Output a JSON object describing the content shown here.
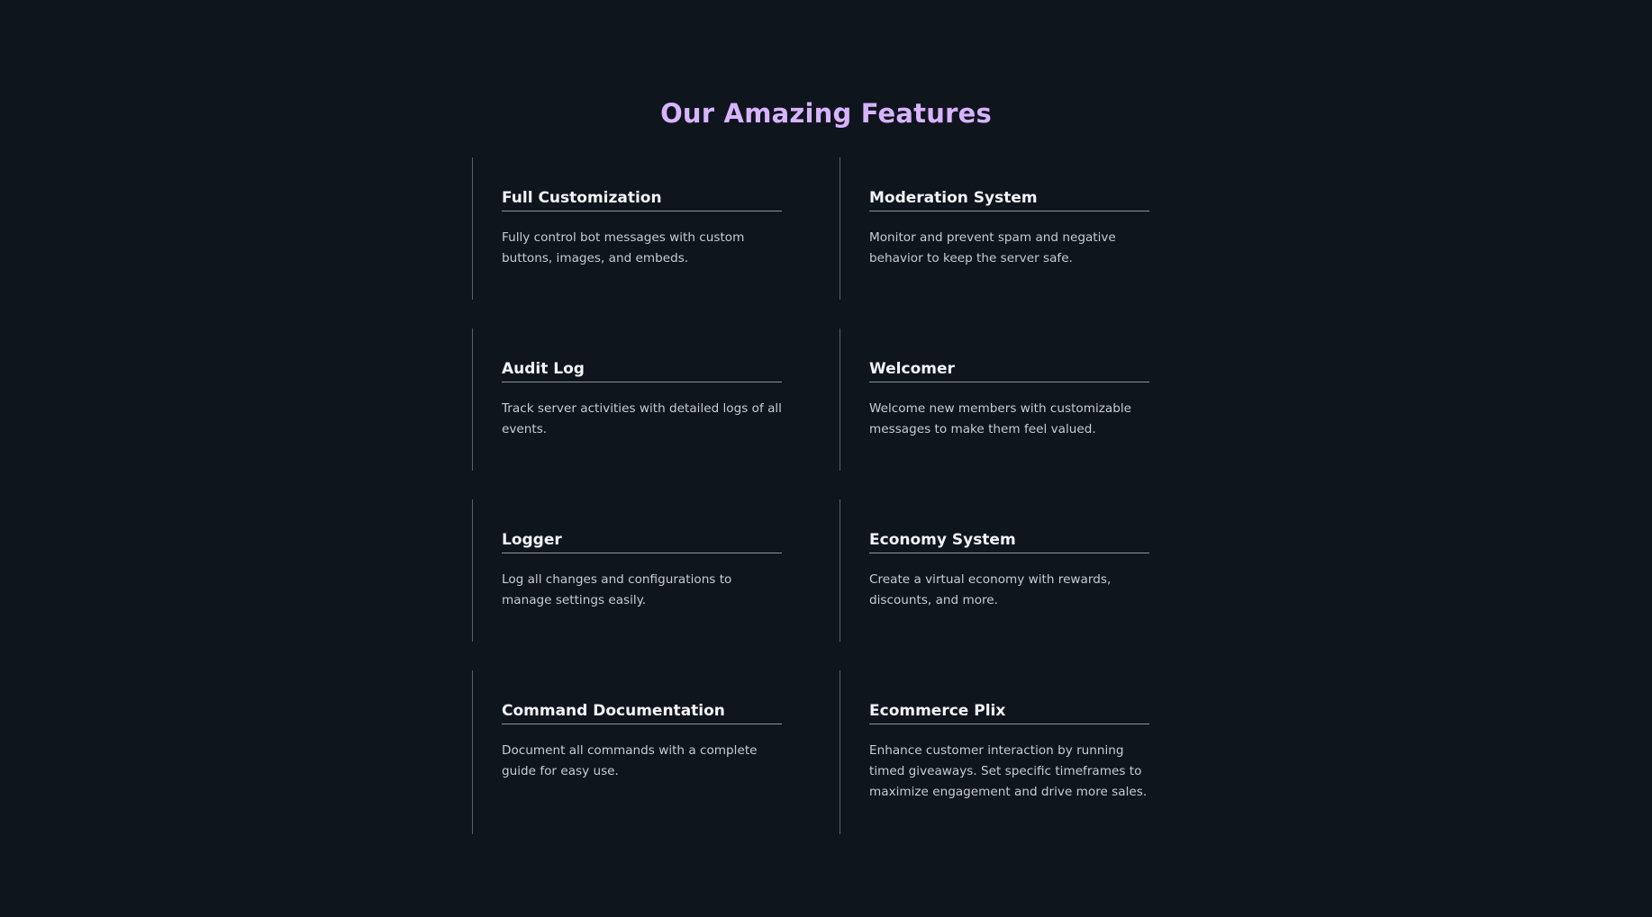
{
  "section": {
    "title": "Our Amazing Features"
  },
  "features": [
    {
      "title": "Full Customization",
      "description": "Fully control bot messages with custom buttons, images, and embeds."
    },
    {
      "title": "Moderation System",
      "description": "Monitor and prevent spam and negative behavior to keep the server safe."
    },
    {
      "title": "Audit Log",
      "description": "Track server activities with detailed logs of all events."
    },
    {
      "title": "Welcomer",
      "description": "Welcome new members with customizable messages to make them feel valued."
    },
    {
      "title": "Logger",
      "description": "Log all changes and configurations to manage settings easily."
    },
    {
      "title": "Economy System",
      "description": "Create a virtual economy with rewards, discounts, and more."
    },
    {
      "title": "Command Documentation",
      "description": "Document all commands with a complete guide for easy use."
    },
    {
      "title": "Ecommerce Plix",
      "description": "Enhance customer interaction by running timed giveaways. Set specific timeframes to maximize engagement and drive more sales."
    }
  ],
  "colors": {
    "background": "#0e151d",
    "heading_accent": "#d8b3ff",
    "card_title": "#f3f4f6",
    "card_text": "#c8ccd1",
    "divider": "#59616a"
  }
}
